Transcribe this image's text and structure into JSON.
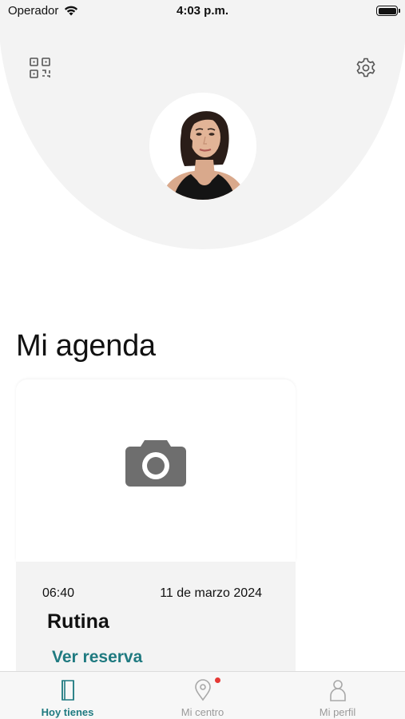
{
  "status_bar": {
    "carrier": "Operador",
    "time": "4:03 p.m."
  },
  "header": {
    "qr_icon": "qr-code-icon",
    "settings_icon": "gear-icon",
    "avatar_alt": "avatar"
  },
  "agenda": {
    "title": "Mi agenda",
    "card": {
      "image_placeholder_icon": "camera-icon",
      "time": "06:40",
      "date": "11 de marzo 2024",
      "title": "Rutina",
      "link": "Ver reserva"
    }
  },
  "tab_bar": {
    "tabs": [
      {
        "label": "Hoy tienes",
        "icon": "notebook-icon",
        "active": true
      },
      {
        "label": "Mi centro",
        "icon": "location-pin-icon",
        "active": false,
        "badge": true
      },
      {
        "label": "Mi perfil",
        "icon": "person-icon",
        "active": false
      }
    ]
  },
  "colors": {
    "accent": "#1f7a80",
    "header_bg": "#f3f3f3",
    "badge": "#e53935",
    "tab_inactive": "#9a9a9a"
  }
}
